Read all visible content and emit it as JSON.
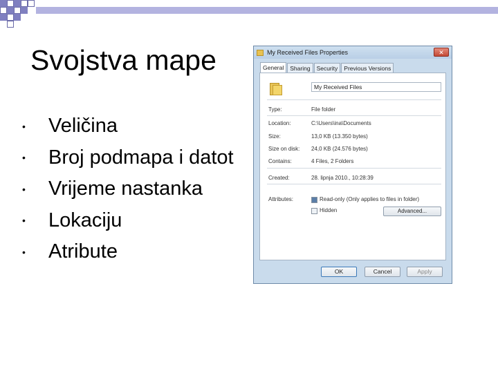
{
  "slide": {
    "title": "Svojstva mape",
    "bullets": [
      "Veličina",
      "Broj podmapa i datot",
      "Vrijeme nastanka",
      "Lokaciju",
      "Atribute"
    ]
  },
  "dialog": {
    "title": "My Received Files Properties",
    "close_glyph": "✕",
    "tabs": [
      "General",
      "Sharing",
      "Security",
      "Previous Versions"
    ],
    "active_tab": "General",
    "folder_name": "My Received Files",
    "properties": [
      {
        "label": "Type:",
        "value": "File folder"
      },
      {
        "label": "Location:",
        "value": "C:\\Users\\ina\\Documents"
      },
      {
        "label": "Size:",
        "value": "13,0 KB (13.350 bytes)"
      },
      {
        "label": "Size on disk:",
        "value": "24,0 KB (24.576 bytes)"
      },
      {
        "label": "Contains:",
        "value": "4 Files, 2 Folders"
      },
      {
        "label": "Created:",
        "value": "28. lipnja 2010., 10:28:39"
      }
    ],
    "attributes_label": "Attributes:",
    "readonly_label": "Read-only (Only applies to files in folder)",
    "readonly_checked": true,
    "hidden_label": "Hidden",
    "hidden_checked": false,
    "advanced_button": "Advanced...",
    "ok_button": "OK",
    "cancel_button": "Cancel",
    "apply_button": "Apply"
  },
  "colors": {
    "deco_fill": "#8080c0",
    "deco_bar": "#b3b3e0",
    "dialog_frame": "#c9dbec"
  }
}
